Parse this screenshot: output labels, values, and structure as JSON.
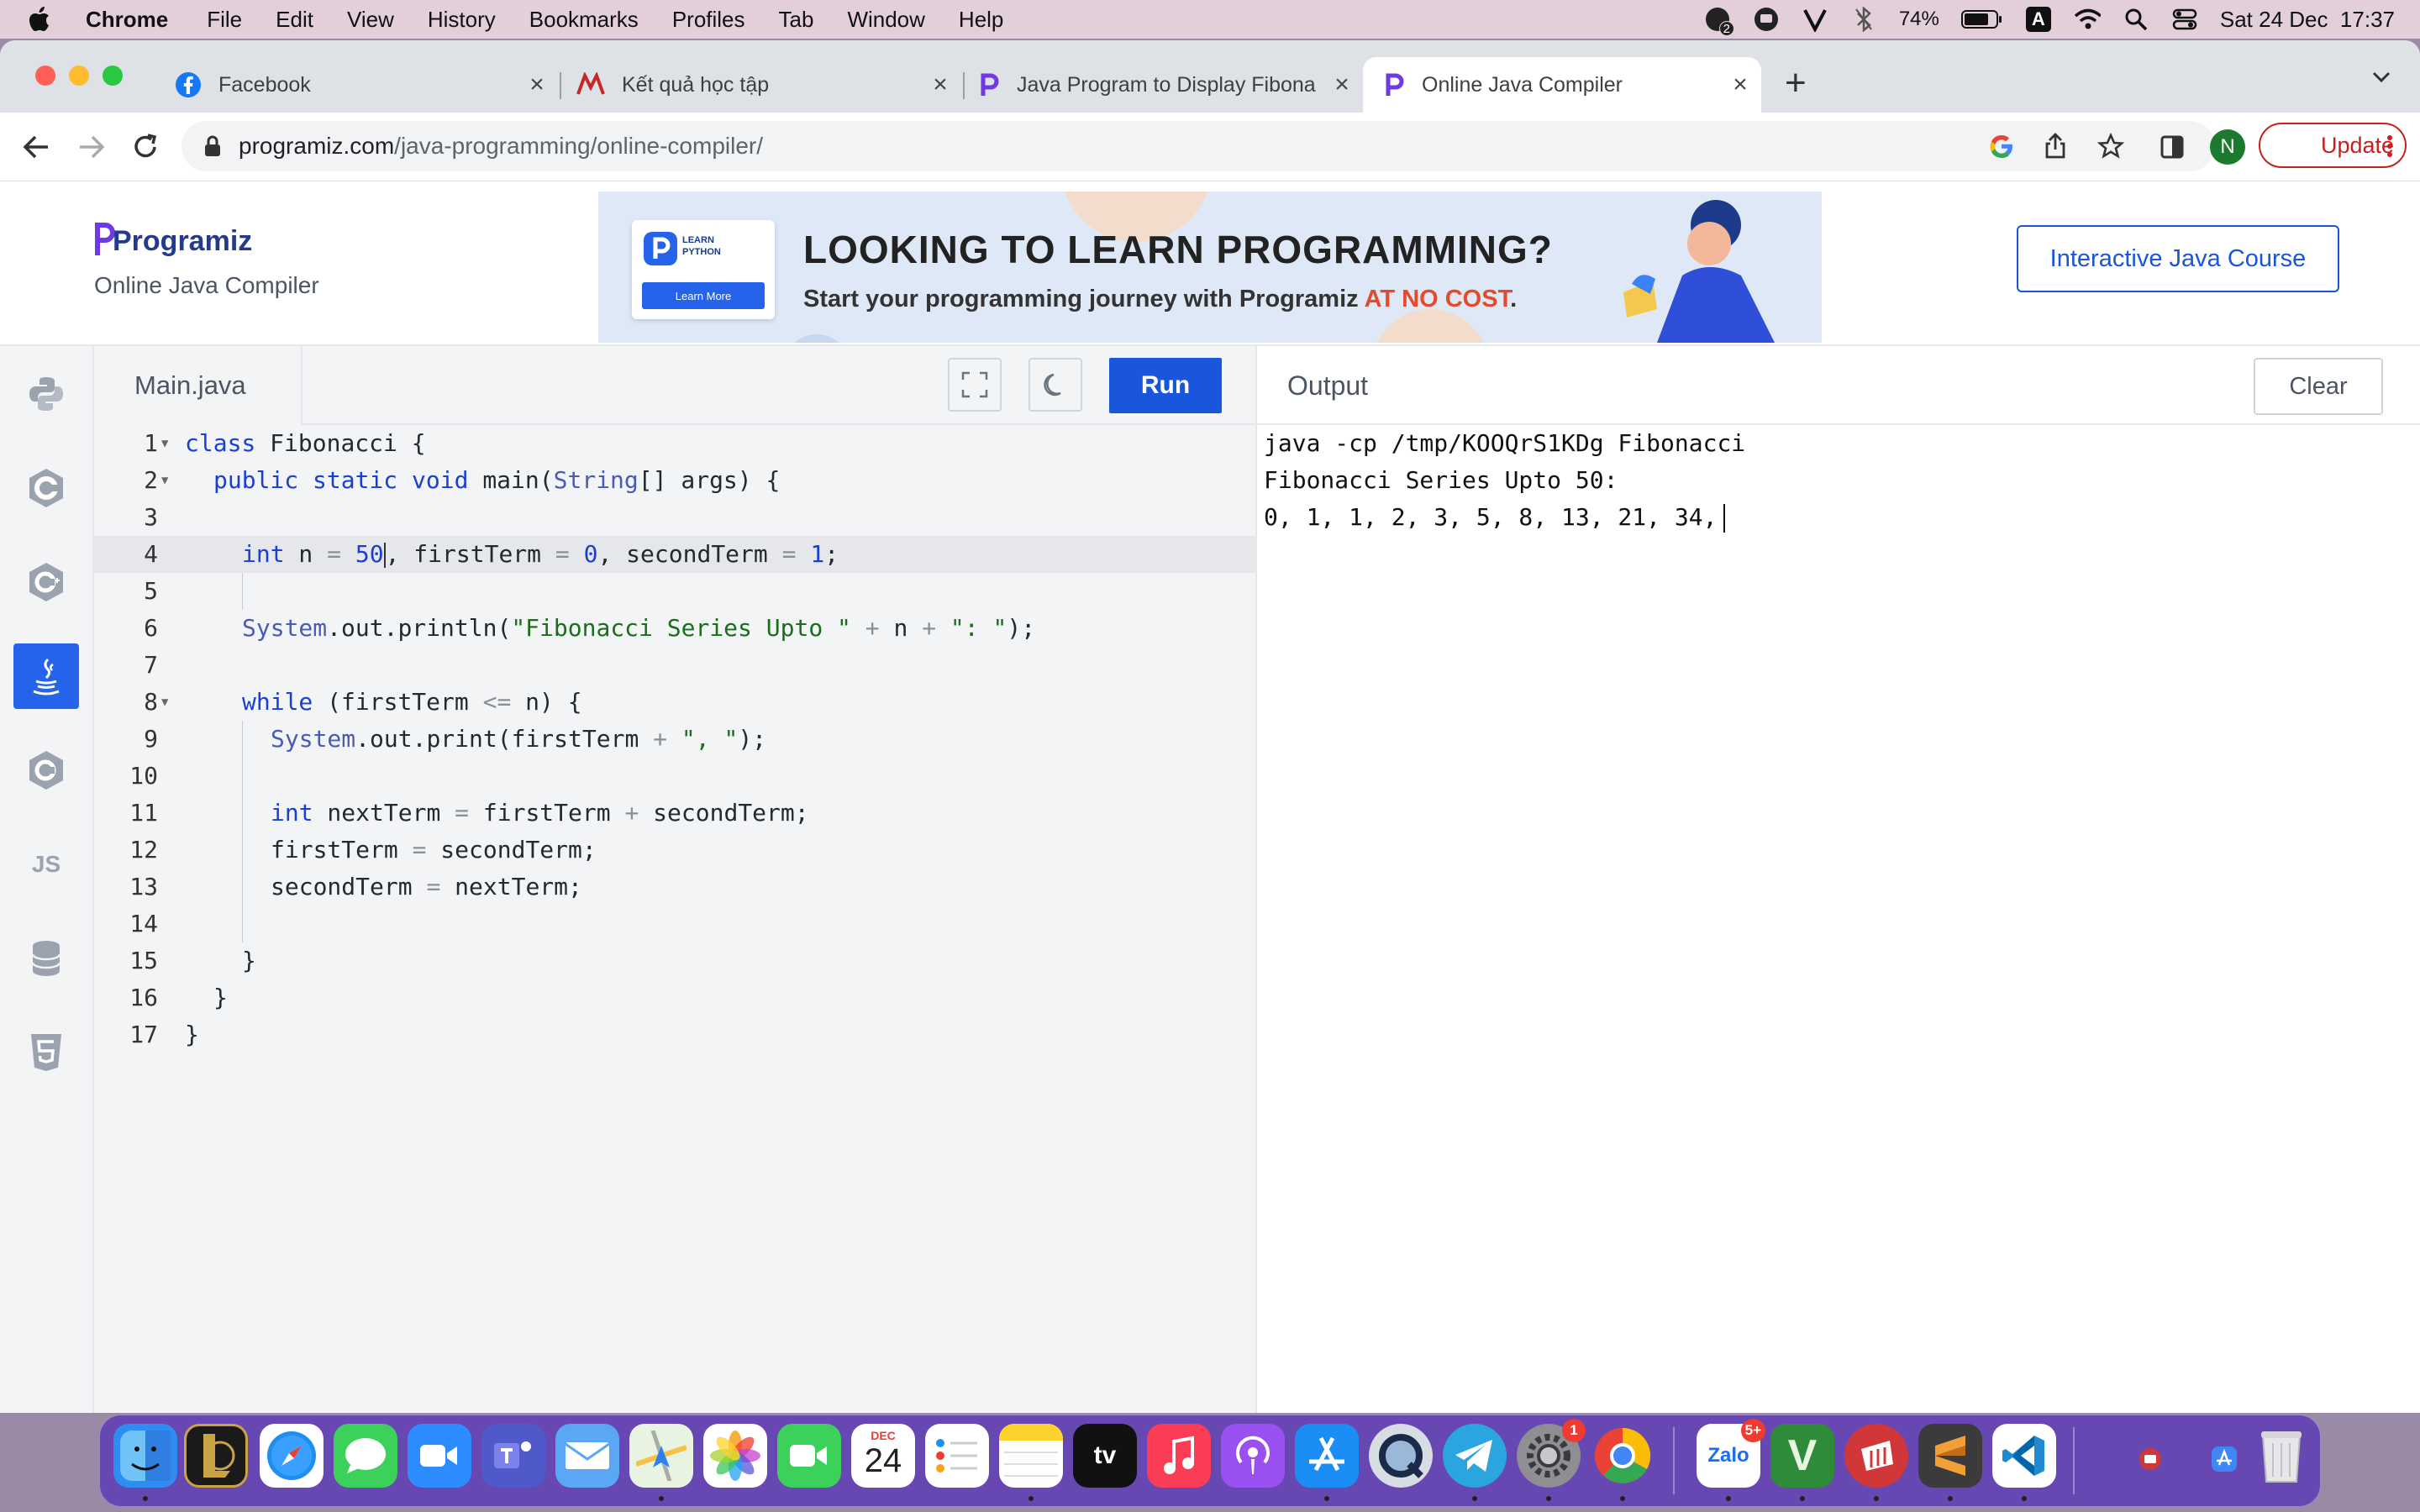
{
  "menubar": {
    "app": "Chrome",
    "items": [
      "File",
      "Edit",
      "View",
      "History",
      "Bookmarks",
      "Profiles",
      "Tab",
      "Window",
      "Help"
    ],
    "battery": "74%",
    "input_source": "A",
    "datetime": "Sat 24 Dec  17:37",
    "notification_count": "2"
  },
  "tabs": [
    {
      "title": "Facebook"
    },
    {
      "title": "Kết quả học tập"
    },
    {
      "title": "Java Program to Display Fibona"
    },
    {
      "title": "Online Java Compiler"
    }
  ],
  "new_tab_symbol": "+",
  "address": {
    "host": "programiz.com",
    "path": "/java-programming/online-compiler/"
  },
  "profile_initial": "N",
  "update_label": "Update",
  "header": {
    "logo": "Programiz",
    "subtitle": "Online Java Compiler",
    "course_button": "Interactive Java Course"
  },
  "banner": {
    "headline": "LOOKING TO LEARN PROGRAMMING?",
    "sub_text": "Start your programming journey with Programiz ",
    "sub_highlight": "AT NO COST",
    "sub_end": ".",
    "badge_line1": "LEARN",
    "badge_line2": "PYTHON",
    "cta": "Learn More"
  },
  "sidebar": {
    "js_label": "JS"
  },
  "editor": {
    "file_tab": "Main.java",
    "run_label": "Run",
    "line_numbers": [
      "1",
      "2",
      "3",
      "4",
      "5",
      "6",
      "7",
      "8",
      "9",
      "10",
      "11",
      "12",
      "13",
      "14",
      "15",
      "16",
      "17"
    ],
    "code": {
      "l1a": "class",
      "l1b": " Fibonacci {",
      "l2a": "public",
      "l2b": "static",
      "l2c": "void",
      "l2d": " main(",
      "l2e": "String",
      "l2f": "[] args) {",
      "l4a": "int",
      "l4b": " n ",
      "l4c": "=",
      "l4d": "50",
      "l4e": ", firstTerm ",
      "l4f": "=",
      "l4g": "0",
      "l4h": ", secondTerm ",
      "l4i": "=",
      "l4j": "1",
      "l4k": ";",
      "l6a": "System",
      "l6b": ".out.println(",
      "l6c": "\"Fibonacci Series Upto \"",
      "l6d": "+",
      "l6e": " n ",
      "l6f": "+",
      "l6g": "\": \"",
      "l6h": ");",
      "l8a": "while",
      "l8b": " (firstTerm ",
      "l8c": "<=",
      "l8d": " n) {",
      "l9a": "System",
      "l9b": ".out.print(firstTerm ",
      "l9c": "+",
      "l9d": "\", \"",
      "l9e": ");",
      "l11a": "int",
      "l11b": " nextTerm ",
      "l11c": "=",
      "l11d": " firstTerm ",
      "l11e": "+",
      "l11f": " secondTerm;",
      "l12a": "firstTerm ",
      "l12b": "=",
      "l12c": " secondTerm;",
      "l13a": "secondTerm ",
      "l13b": "=",
      "l13c": " nextTerm;",
      "l15": "}",
      "l16": "}",
      "l17": "}"
    }
  },
  "output": {
    "title": "Output",
    "clear_label": "Clear",
    "lines": [
      "java -cp /tmp/KOOQrS1KDg Fibonacci",
      "Fibonacci Series Upto 50:",
      "0, 1, 1, 2, 3, 5, 8, 13, 21, 34,"
    ]
  },
  "dock": {
    "calendar_month": "DEC",
    "calendar_day": "24",
    "tv_label": "tv",
    "zalo_label": "Zalo",
    "zalo_badge": "5+",
    "settings_badge": "1",
    "vim_label": "V"
  }
}
